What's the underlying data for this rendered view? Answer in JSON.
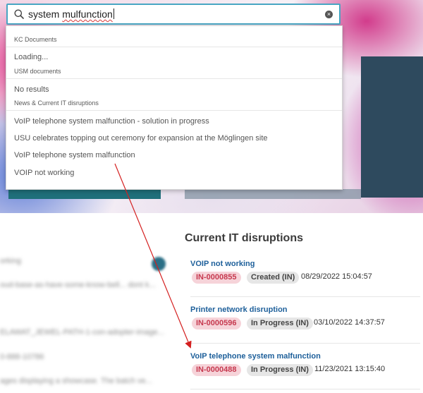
{
  "search": {
    "query_prefix": "system ",
    "query_misspelled": "mulfunction",
    "placeholder": "",
    "value": "system mulfunction"
  },
  "dropdown": {
    "kc_documents": {
      "heading": "KC Documents",
      "status": "Loading..."
    },
    "usm_documents": {
      "heading": "USM documents",
      "status": "No results"
    },
    "news": {
      "heading": "News & Current IT disruptions",
      "items": [
        "VoIP telephone system malfunction - solution in progress",
        "USU celebrates topping out ceremony for expansion at the Möglingen site",
        "VoIP telephone system malfunction",
        "VOIP not working"
      ]
    }
  },
  "disruptions": {
    "title": "Current IT disruptions",
    "items": [
      {
        "title": "VOIP not working",
        "id": "IN-0000855",
        "status": "Created (IN)",
        "date": "08/29/2022 15:04:57"
      },
      {
        "title": "Printer network disruption",
        "id": "IN-0000596",
        "status": "In Progress (IN)",
        "date": "03/10/2022 14:37:57"
      },
      {
        "title": "VoIP telephone system malfunction",
        "id": "IN-0000488",
        "status": "In Progress (IN)",
        "date": "11/23/2021 13:15:40"
      }
    ]
  },
  "left_blurred": [
    "orking",
    "oud-base-as-have-some-know-bell... dont k...",
    "ELAWAT_JEWEL-PATH-1-con-adopter-image...",
    "0-888-10786",
    "ages displaying a showcase. The batch ve..."
  ],
  "colors": {
    "accent": "#48a6c3",
    "link": "#1d5f9a",
    "badge_id_bg": "#f6d3d9",
    "badge_id_text": "#c6394f",
    "arrow": "#d42020"
  }
}
